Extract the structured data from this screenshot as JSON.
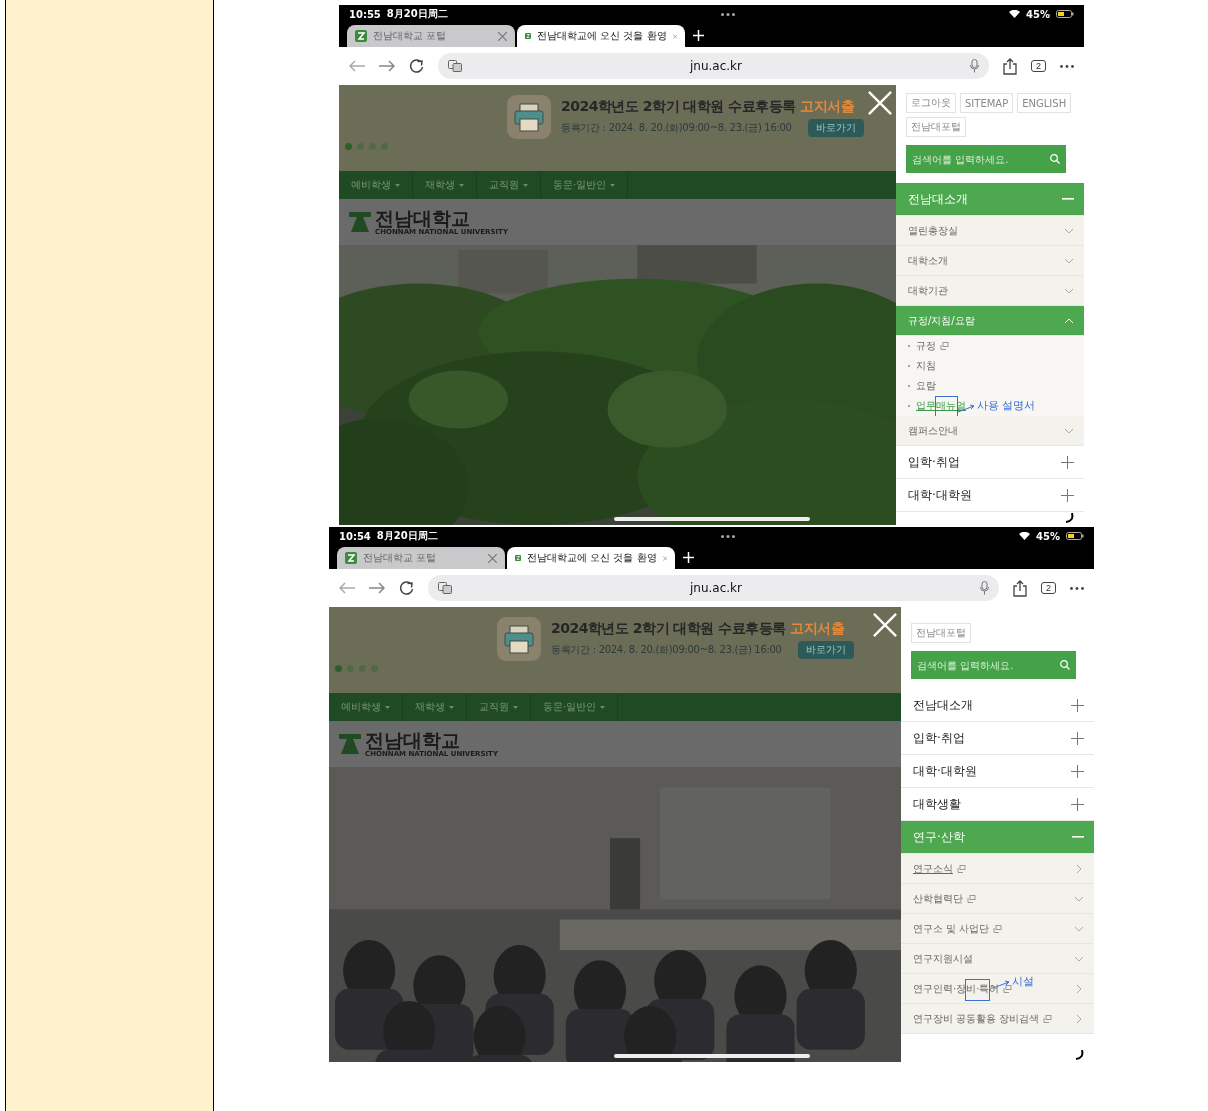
{
  "screens": [
    {
      "status": {
        "time": "10:55",
        "date": "8月20日周二",
        "battery": "45%"
      },
      "tabs": [
        {
          "label": "전남대학교 포털",
          "selected": false
        },
        {
          "label": "전남대학교에 오신 것을 환영",
          "selected": true
        }
      ],
      "url": "jnu.ac.kr",
      "tab_count": "2",
      "banner": {
        "title": "2024학년도 2학기 대학원 수료후등록 ",
        "title_highlight": "고지서출",
        "period": "등록기간 : 2024. 8. 20.(화)09:00~8. 23.(금) 16:00",
        "button": "바로가기"
      },
      "dots": [
        {
          "selected": true
        },
        {
          "selected": false
        },
        {
          "selected": false
        },
        {
          "selected": false
        }
      ],
      "nav": [
        "예비학생",
        "재학생",
        "교직원",
        "동문·일반인"
      ],
      "logo": {
        "name": "전남대학교",
        "subtitle": "CHONNAM NATIONAL UNIVERSITY"
      },
      "photo": {
        "kind": "picture"
      },
      "util_buttons": [
        "로그아웃",
        "SITEMAP",
        "ENGLISH",
        "전남대포털"
      ],
      "search": {
        "placeholder": "검색어를 입력하세요."
      },
      "menu": [
        {
          "label": "전남대소개",
          "kind": "section",
          "expanded": true
        },
        {
          "label": "열린총장실",
          "kind": "sub",
          "expanded": false
        },
        {
          "label": "대학소개",
          "kind": "sub",
          "expanded": false
        },
        {
          "label": "대학기관",
          "kind": "sub",
          "expanded": false
        },
        {
          "label": "규정/지침/요람",
          "kind": "sub",
          "expanded": true
        },
        {
          "label": "규정",
          "kind": "link",
          "external": true,
          "underlined": false
        },
        {
          "label": "지침",
          "kind": "link",
          "external": false,
          "underlined": false
        },
        {
          "label": "요람",
          "kind": "link",
          "external": false,
          "underlined": false
        },
        {
          "label": "업무매뉴얼",
          "kind": "link",
          "external": false,
          "underlined": true,
          "annotation": "사용 설명서"
        },
        {
          "label": "캠퍼스안내",
          "kind": "sub",
          "expanded": false
        },
        {
          "label": "입학·취업",
          "kind": "section",
          "expanded": false
        },
        {
          "label": "대학·대학원",
          "kind": "section",
          "expanded": false
        }
      ]
    },
    {
      "status": {
        "time": "10:54",
        "date": "8月20日周二",
        "battery": "45%"
      },
      "tabs": [
        {
          "label": "전남대학교 포털",
          "selected": false
        },
        {
          "label": "전남대학교에 오신 것을 환영",
          "selected": true
        }
      ],
      "url": "jnu.ac.kr",
      "tab_count": "2",
      "banner": {
        "title": "2024학년도 2학기 대학원 수료후등록 ",
        "title_highlight": "고지서출",
        "period": "등록기간 : 2024. 8. 20.(화)09:00~8. 23.(금) 16:00",
        "button": "바로가기"
      },
      "dots": [
        {
          "selected": true
        },
        {
          "selected": false
        },
        {
          "selected": false
        },
        {
          "selected": false
        }
      ],
      "nav": [
        "예비학생",
        "재학생",
        "교직원",
        "동문·일반인"
      ],
      "logo": {
        "name": "전남대학교",
        "subtitle": "CHONNAM NATIONAL UNIVERSITY"
      },
      "photo": {
        "kind": "picture"
      },
      "util_buttons": [
        "전남대포털"
      ],
      "search": {
        "placeholder": "검색어를 입력하세요."
      },
      "menu": [
        {
          "label": "전남대소개",
          "kind": "section",
          "expanded": false
        },
        {
          "label": "입학·취업",
          "kind": "section",
          "expanded": false
        },
        {
          "label": "대학·대학원",
          "kind": "section",
          "expanded": false
        },
        {
          "label": "대학생활",
          "kind": "section",
          "expanded": false
        },
        {
          "label": "연구·산학",
          "kind": "section",
          "expanded": true
        },
        {
          "label": "연구소식",
          "kind": "page",
          "external": true,
          "underlined": true
        },
        {
          "label": "산학협력단",
          "kind": "sub",
          "expanded": false,
          "external": true
        },
        {
          "label": "연구소 및 사업단",
          "kind": "sub",
          "expanded": false,
          "external": true
        },
        {
          "label": "연구지원시설",
          "kind": "sub",
          "expanded": false,
          "external": false
        },
        {
          "label": "연구인력·장비·특허",
          "kind": "page",
          "external": true,
          "underlined": false,
          "annotation": "시설"
        },
        {
          "label": "연구장비 공동활용 장비검색",
          "kind": "page",
          "external": true,
          "underlined": false
        }
      ]
    }
  ]
}
